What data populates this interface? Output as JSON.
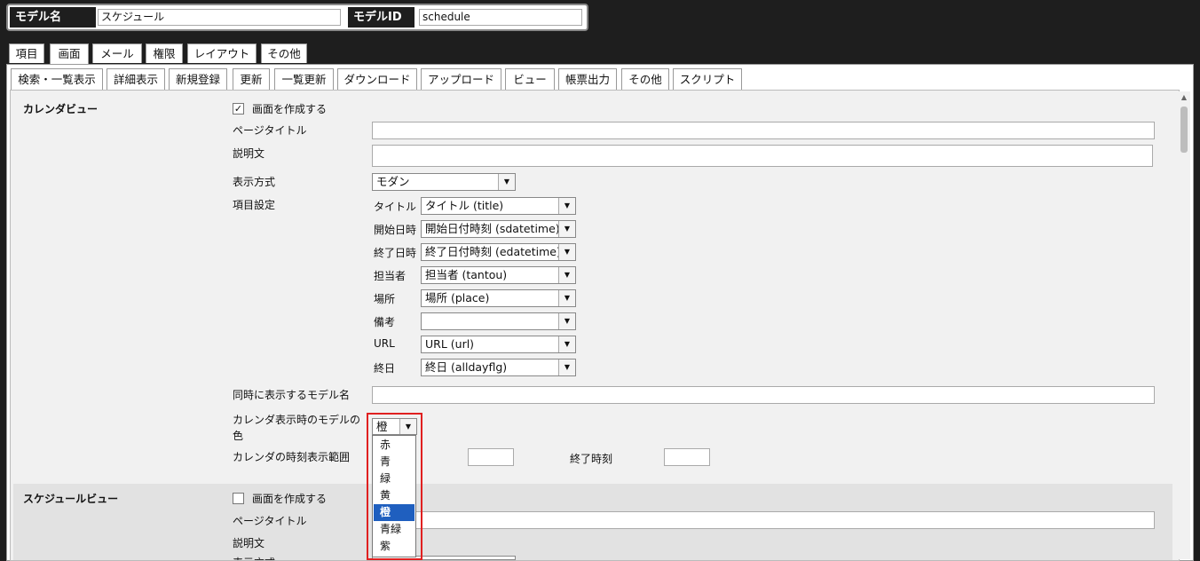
{
  "header": {
    "model_name_label": "モデル名",
    "model_name_value": "スケジュール",
    "model_id_label": "モデルID",
    "model_id_value": "schedule"
  },
  "main_tabs": [
    "項目",
    "画面",
    "メール",
    "権限",
    "レイアウト",
    "その他"
  ],
  "sub_tabs": [
    "検索・一覧表示",
    "詳細表示",
    "新規登録",
    "更新",
    "一覧更新",
    "ダウンロード",
    "アップロード",
    "ビュー",
    "帳票出力",
    "その他",
    "スクリプト"
  ],
  "calendar": {
    "section_title": "カレンダビュー",
    "create_label": "画面を作成する",
    "create_checked": true,
    "page_title_label": "ページタイトル",
    "desc_label": "説明文",
    "display_label": "表示方式",
    "display_value": "モダン",
    "items_label": "項目設定",
    "fields": [
      {
        "label": "タイトル",
        "value": "タイトル (title)"
      },
      {
        "label": "開始日時",
        "value": "開始日付時刻 (sdatetime)"
      },
      {
        "label": "終了日時",
        "value": "終了日付時刻 (edatetime)"
      },
      {
        "label": "担当者",
        "value": "担当者 (tantou)"
      },
      {
        "label": "場所",
        "value": "場所 (place)"
      },
      {
        "label": "備考",
        "value": ""
      },
      {
        "label": "URL",
        "value": "URL (url)"
      },
      {
        "label": "終日",
        "value": "終日 (alldayflg)"
      }
    ],
    "concurrent_label": "同時に表示するモデル名",
    "color_label_1": "カレンダ表示時のモデルの",
    "color_label_2": "色",
    "color_value": "橙",
    "color_options": [
      "赤",
      "青",
      "緑",
      "黄",
      "橙",
      "青緑",
      "紫"
    ],
    "color_selected_index": 4,
    "time_range_label": "カレンダの時刻表示範囲",
    "end_time_label": "終了時刻"
  },
  "schedule": {
    "section_title": "スケジュールビュー",
    "create_label": "画面を作成する",
    "create_checked": false,
    "page_title_label": "ページタイトル",
    "desc_label": "説明文",
    "display_label": "表示方式"
  }
}
